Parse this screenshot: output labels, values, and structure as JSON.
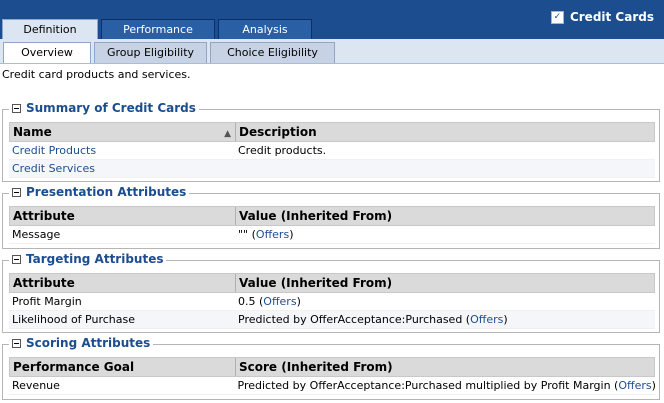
{
  "top_tabs": [
    {
      "label": "Definition",
      "active": true
    },
    {
      "label": "Performance",
      "active": false
    },
    {
      "label": "Analysis",
      "active": false
    }
  ],
  "brand": {
    "title": "Credit Cards",
    "icon": "checkbox-icon"
  },
  "sub_tabs": [
    {
      "label": "Overview",
      "active": true
    },
    {
      "label": "Group Eligibility",
      "active": false
    },
    {
      "label": "Choice Eligibility",
      "active": false
    }
  ],
  "description": "Credit card products and services.",
  "sections": {
    "summary": {
      "title": "Summary of Credit Cards",
      "headers": [
        "Name",
        "Description"
      ],
      "rows": [
        {
          "name": "Credit Products",
          "description": "Credit products."
        },
        {
          "name": "Credit Services",
          "description": ""
        }
      ]
    },
    "presentation": {
      "title": "Presentation Attributes",
      "headers": [
        "Attribute",
        "Value (Inherited From)"
      ],
      "rows": [
        {
          "attribute": "Message",
          "value_prefix": "\"\" (",
          "link": "Offers",
          "value_suffix": ")"
        }
      ]
    },
    "targeting": {
      "title": "Targeting Attributes",
      "headers": [
        "Attribute",
        "Value (Inherited From)"
      ],
      "rows": [
        {
          "attribute": "Profit Margin",
          "value_prefix": "0.5 (",
          "link": "Offers",
          "value_suffix": ")"
        },
        {
          "attribute": "Likelihood of Purchase",
          "value_prefix": "Predicted by OfferAcceptance:Purchased (",
          "link": "Offers",
          "value_suffix": ")"
        }
      ]
    },
    "scoring": {
      "title": "Scoring Attributes",
      "headers": [
        "Performance Goal",
        "Score (Inherited From)"
      ],
      "rows": [
        {
          "attribute": "Revenue",
          "value_prefix": "Predicted by OfferAcceptance:Purchased multiplied by Profit Margin (",
          "link": "Offers",
          "value_suffix": ")"
        }
      ]
    }
  },
  "colors": {
    "header_bar": "#1c4d8f",
    "link": "#1c4d8f",
    "section_title": "#1c4d8f"
  }
}
